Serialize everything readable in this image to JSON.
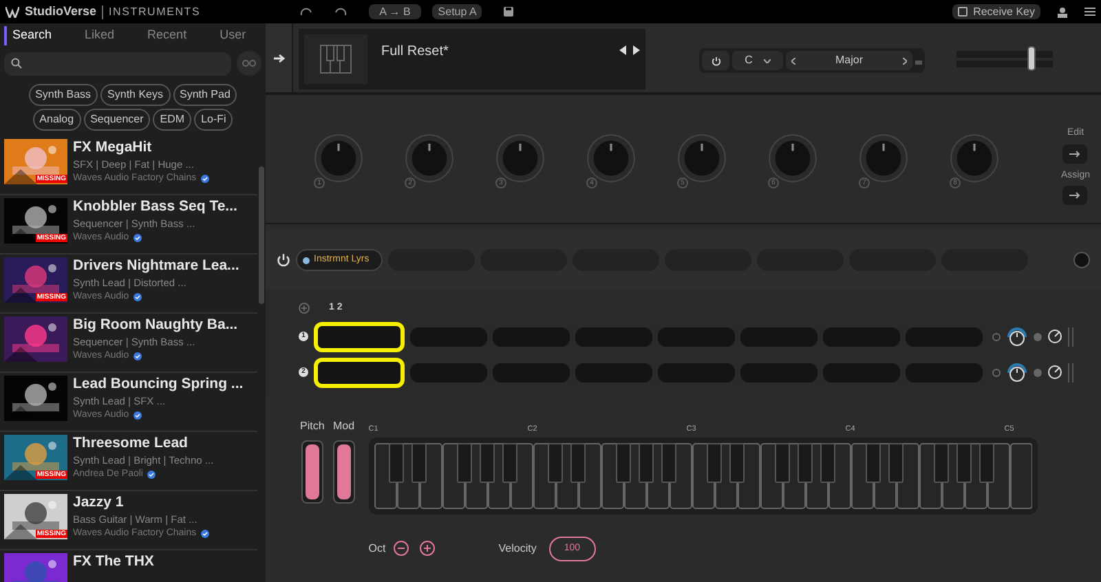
{
  "app": {
    "brand": "StudioVerse",
    "section": "INSTRUMENTS"
  },
  "toolbar": {
    "ab": "A → B",
    "setup": "Setup A",
    "receive_key": {
      "label": "Receive Key",
      "checked": false
    }
  },
  "sidebar": {
    "tabs": [
      {
        "label": "Search",
        "selected": true
      },
      {
        "label": "Liked",
        "selected": false
      },
      {
        "label": "Recent",
        "selected": false
      },
      {
        "label": "User",
        "selected": false
      }
    ],
    "tags": [
      [
        "Synth Bass",
        "Synth Keys",
        "Synth Pad"
      ],
      [
        "Analog",
        "Sequencer",
        "EDM",
        "Lo-Fi"
      ]
    ],
    "presets": [
      {
        "title": "FX MegaHit",
        "tags": "SFX | Deep | Fat | Huge ...",
        "author": "Waves Audio Factory Chains",
        "badge": "MISSING",
        "verified": true
      },
      {
        "title": "Knobbler Bass Seq Te...",
        "tags": "Sequencer | Synth Bass ...",
        "author": "Waves Audio",
        "badge": "MISSING",
        "verified": true
      },
      {
        "title": "Drivers Nightmare Lea...",
        "tags": "Synth Lead | Distorted ...",
        "author": "Waves Audio",
        "badge": "MISSING",
        "verified": true
      },
      {
        "title": "Big Room Naughty Ba...",
        "tags": "Sequencer | Synth Bass ...",
        "author": "Waves Audio",
        "verified": true
      },
      {
        "title": "Lead Bouncing Spring ...",
        "tags": "Synth Lead | SFX ...",
        "author": "Waves Audio",
        "verified": true
      },
      {
        "title": "Threesome Lead",
        "tags": "Synth Lead | Bright | Techno ...",
        "author": "Andrea De Paoli",
        "badge": "MISSING",
        "verified": true
      },
      {
        "title": "Jazzy 1",
        "tags": "Bass Guitar | Warm | Fat ...",
        "author": "Waves Audio Factory Chains",
        "badge": "MISSING",
        "verified": true
      },
      {
        "title": "FX The THX"
      }
    ]
  },
  "preset": {
    "name": "Full Reset*"
  },
  "scale": {
    "on": true,
    "root": "C",
    "mode": "Major"
  },
  "macros": {
    "knobs": [
      "1",
      "2",
      "3",
      "4",
      "5",
      "6",
      "7",
      "8"
    ],
    "edit": "Edit",
    "assign": "Assign"
  },
  "layers": {
    "tabs": [
      {
        "label": "Instrmnt Lyrs",
        "selected": true
      },
      {
        "selected": false
      },
      {
        "selected": false
      },
      {
        "selected": false
      },
      {
        "selected": false
      },
      {
        "selected": false
      },
      {
        "selected": false
      },
      {
        "selected": false
      }
    ],
    "columns": "1 2",
    "rows": [
      {
        "number": "1",
        "highlighted": true
      },
      {
        "number": "2",
        "highlighted": true
      }
    ]
  },
  "keyboard": {
    "pitch": "Pitch",
    "mod": "Mod",
    "octaves": [
      "C1",
      "C2",
      "C3",
      "C4",
      "C5"
    ],
    "oct": "Oct",
    "velocity_label": "Velocity",
    "velocity": "100"
  }
}
